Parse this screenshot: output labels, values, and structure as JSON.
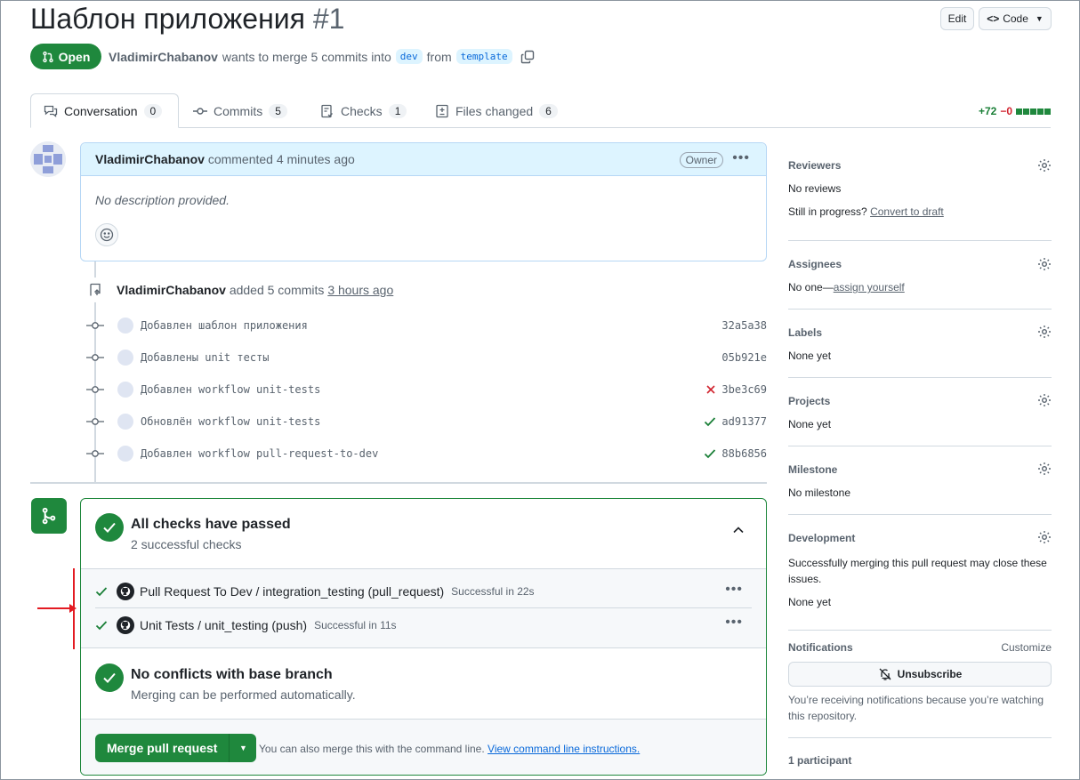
{
  "pr": {
    "title": "Шаблон приложения",
    "number": "#1",
    "state": "Open",
    "author": "VladimirChabanov",
    "merge_text": "wants to merge 5 commits into",
    "base_branch": "dev",
    "from_text": "from",
    "head_branch": "template"
  },
  "header_actions": {
    "edit_label": "Edit",
    "code_label": "Code"
  },
  "tabs": [
    {
      "label": "Conversation",
      "count": "0"
    },
    {
      "label": "Commits",
      "count": "5"
    },
    {
      "label": "Checks",
      "count": "1"
    },
    {
      "label": "Files changed",
      "count": "6"
    }
  ],
  "diffstat": {
    "added": "+72",
    "removed": "−0"
  },
  "comment": {
    "author": "VladimirChabanov",
    "action": "commented 4 minutes ago",
    "badge": "Owner",
    "body": "No description provided."
  },
  "commits_event": {
    "author": "VladimirChabanov",
    "action": "added 5 commits",
    "time": "3 hours ago"
  },
  "commits": [
    {
      "message": "Добавлен шаблон приложения",
      "sha": "32a5a38",
      "status": ""
    },
    {
      "message": "Добавлены unit тесты",
      "sha": "05b921e",
      "status": ""
    },
    {
      "message": "Добавлен workflow unit-tests",
      "sha": "3be3c69",
      "status": "fail"
    },
    {
      "message": "Обновлён workflow unit-tests",
      "sha": "ad91377",
      "status": "pass"
    },
    {
      "message": "Добавлен workflow pull-request-to-dev",
      "sha": "88b6856",
      "status": "pass"
    }
  ],
  "checks": {
    "title": "All checks have passed",
    "subtitle": "2 successful checks",
    "items": [
      {
        "name": "Pull Request To Dev / integration_testing (pull_request)",
        "status": "Successful in 22s"
      },
      {
        "name": "Unit Tests / unit_testing (push)",
        "status": "Successful in 11s"
      }
    ]
  },
  "conflicts": {
    "title": "No conflicts with base branch",
    "subtitle": "Merging can be performed automatically."
  },
  "merge": {
    "button_label": "Merge pull request",
    "hint": "You can also merge this with the command line.",
    "hint_link": "View command line instructions."
  },
  "sidebar": {
    "reviewers": {
      "title": "Reviewers",
      "value": "No reviews",
      "extra": "Still in progress?",
      "extra_link": "Convert to draft"
    },
    "assignees": {
      "title": "Assignees",
      "value": "No one—",
      "link": "assign yourself"
    },
    "labels": {
      "title": "Labels",
      "value": "None yet"
    },
    "projects": {
      "title": "Projects",
      "value": "None yet"
    },
    "milestone": {
      "title": "Milestone",
      "value": "No milestone"
    },
    "development": {
      "title": "Development",
      "value": "Successfully merging this pull request may close these issues.",
      "extra": "None yet"
    },
    "notifications": {
      "title": "Notifications",
      "customize": "Customize",
      "button": "Unsubscribe",
      "note": "You’re receiving notifications because you’re watching this repository."
    },
    "participants": {
      "title": "1 participant"
    }
  },
  "colors": {
    "success": "#1f883d",
    "danger": "#d1242f",
    "accent": "#0969da",
    "annotation": "#e31b23"
  }
}
